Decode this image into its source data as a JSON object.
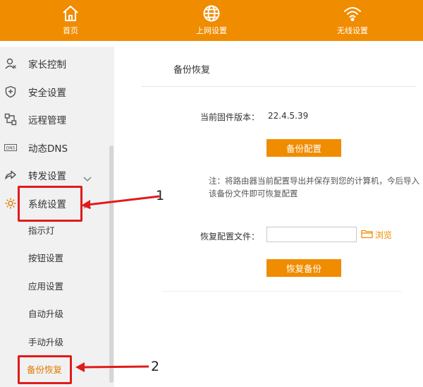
{
  "topnav": {
    "items": [
      {
        "label": "首页",
        "icon": "home-icon"
      },
      {
        "label": "上网设置",
        "icon": "globe-icon"
      },
      {
        "label": "无线设置",
        "icon": "wifi-icon"
      }
    ]
  },
  "sidebar": {
    "items": [
      {
        "label": "家长控制",
        "icon": "user-icon"
      },
      {
        "label": "安全设置",
        "icon": "shield-icon"
      },
      {
        "label": "远程管理",
        "icon": "remote-icon"
      },
      {
        "label": "动态DNS",
        "icon": "dns-icon"
      },
      {
        "label": "转发设置",
        "icon": "forward-icon"
      },
      {
        "label": "系统设置",
        "icon": "gear-icon"
      }
    ],
    "subitems": [
      "指示灯",
      "按钮设置",
      "应用设置",
      "自动升级",
      "手动升级",
      "备份恢复"
    ]
  },
  "main": {
    "title": "备份恢复",
    "firmware_label": "当前固件版本：",
    "firmware_value": "22.4.5.39",
    "backup_button": "备份配置",
    "note": "注：将路由器当前配置导出并保存到您的计算机，今后导入该备份文件即可恢复配置",
    "restore_label": "恢复配置文件：",
    "file_value": "",
    "browse_label": "浏览",
    "restore_button": "恢复备份"
  },
  "annotations": {
    "one": "1",
    "two": "2"
  },
  "colors": {
    "accent": "#f08c00",
    "highlight": "#e11b1b"
  }
}
